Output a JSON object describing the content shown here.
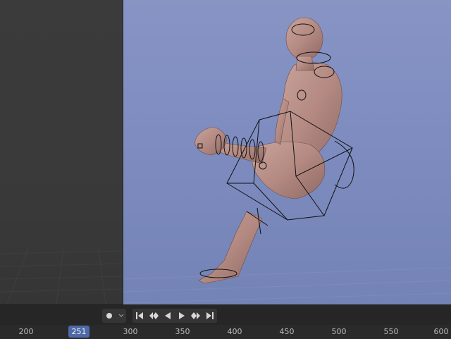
{
  "viewport": {
    "scene": "posed human figure with rig controls",
    "background_color": "#7e8cc0",
    "left_panel_color": "#3a3a3a"
  },
  "playback": {
    "record_icon": "record-icon",
    "record_dropdown_icon": "chevron-down-icon",
    "buttons": [
      {
        "name": "jump-to-start",
        "icon": "skip-start-icon"
      },
      {
        "name": "jump-to-previous-keyframe",
        "icon": "prev-keyframe-icon"
      },
      {
        "name": "play-reverse",
        "icon": "play-reverse-icon"
      },
      {
        "name": "play",
        "icon": "play-icon"
      },
      {
        "name": "jump-to-next-keyframe",
        "icon": "next-keyframe-icon"
      },
      {
        "name": "jump-to-end",
        "icon": "skip-end-icon"
      }
    ]
  },
  "timeline": {
    "current_frame": "251",
    "current_frame_color": "#4f6aa8",
    "ticks": [
      "200",
      "300",
      "350",
      "400",
      "450",
      "500",
      "550",
      "600"
    ]
  }
}
